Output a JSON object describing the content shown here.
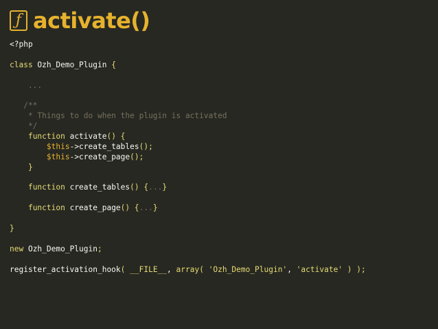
{
  "slide": {
    "title_icon_glyph": "ƒ",
    "title_icon": "function-icon",
    "title": "activate()"
  },
  "code": {
    "lines": [
      [
        {
          "t": "<?php",
          "c": "pl"
        }
      ],
      [],
      [
        {
          "t": "class",
          "c": "kw"
        },
        {
          "t": " Ozh_Demo_Plugin ",
          "c": "pl"
        },
        {
          "t": "{",
          "c": "pn"
        }
      ],
      [],
      [
        {
          "t": "    ...",
          "c": "dim"
        }
      ],
      [],
      [
        {
          "t": "   /**",
          "c": "cm"
        }
      ],
      [
        {
          "t": "    * Things to do when the plugin is activated",
          "c": "cm"
        }
      ],
      [
        {
          "t": "    */",
          "c": "cm"
        }
      ],
      [
        {
          "t": "    ",
          "c": "pl"
        },
        {
          "t": "function",
          "c": "kw"
        },
        {
          "t": " activate",
          "c": "pl"
        },
        {
          "t": "() {",
          "c": "pn"
        }
      ],
      [
        {
          "t": "        ",
          "c": "pl"
        },
        {
          "t": "$this",
          "c": "var"
        },
        {
          "t": "->create_tables",
          "c": "pl"
        },
        {
          "t": "();",
          "c": "pn"
        }
      ],
      [
        {
          "t": "        ",
          "c": "pl"
        },
        {
          "t": "$this",
          "c": "var"
        },
        {
          "t": "->create_page",
          "c": "pl"
        },
        {
          "t": "();",
          "c": "pn"
        }
      ],
      [
        {
          "t": "    ",
          "c": "pl"
        },
        {
          "t": "}",
          "c": "pn"
        }
      ],
      [],
      [
        {
          "t": "    ",
          "c": "pl"
        },
        {
          "t": "function",
          "c": "kw"
        },
        {
          "t": " create_tables",
          "c": "pl"
        },
        {
          "t": "() {",
          "c": "pn"
        },
        {
          "t": "...",
          "c": "dim"
        },
        {
          "t": "}",
          "c": "pn"
        }
      ],
      [],
      [
        {
          "t": "    ",
          "c": "pl"
        },
        {
          "t": "function",
          "c": "kw"
        },
        {
          "t": " create_page",
          "c": "pl"
        },
        {
          "t": "() {",
          "c": "pn"
        },
        {
          "t": "...",
          "c": "dim"
        },
        {
          "t": "}",
          "c": "pn"
        }
      ],
      [],
      [
        {
          "t": "}",
          "c": "pn"
        }
      ],
      [],
      [
        {
          "t": "new",
          "c": "kw"
        },
        {
          "t": " Ozh_Demo_Plugin",
          "c": "pl"
        },
        {
          "t": ";",
          "c": "pn"
        }
      ],
      [],
      [
        {
          "t": "register_activation_hook",
          "c": "pl"
        },
        {
          "t": "( ",
          "c": "pn"
        },
        {
          "t": "__FILE__",
          "c": "kw"
        },
        {
          "t": ", ",
          "c": "pl"
        },
        {
          "t": "array",
          "c": "kw"
        },
        {
          "t": "( ",
          "c": "pn"
        },
        {
          "t": "'Ozh_Demo_Plugin'",
          "c": "str"
        },
        {
          "t": ", ",
          "c": "pl"
        },
        {
          "t": "'activate'",
          "c": "str"
        },
        {
          "t": " ) );",
          "c": "pn"
        }
      ]
    ]
  },
  "colors": {
    "background": "#272822",
    "accent": "#e6b22e",
    "keyword": "#e6db74",
    "comment": "#75715e",
    "text": "#f8f8f2"
  }
}
